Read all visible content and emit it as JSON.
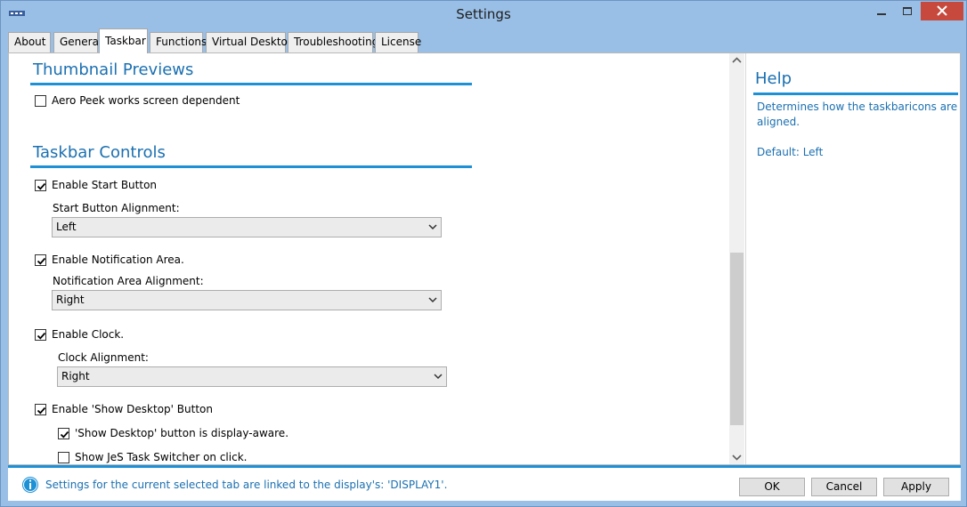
{
  "window": {
    "title": "Settings"
  },
  "tabs": [
    {
      "label": "About"
    },
    {
      "label": "General"
    },
    {
      "label": "Taskbar",
      "active": true
    },
    {
      "label": "Functions"
    },
    {
      "label": "Virtual Desktop"
    },
    {
      "label": "Troubleshooting"
    },
    {
      "label": "License"
    }
  ],
  "thumbnail": {
    "title": "Thumbnail Previews",
    "aero_peek": {
      "label": "Aero Peek works screen dependent",
      "checked": false
    }
  },
  "controls": {
    "title": "Taskbar Controls",
    "start_button": {
      "label": "Enable Start Button",
      "checked": true
    },
    "start_alignment": {
      "label": "Start Button Alignment:",
      "value": "Left"
    },
    "notification": {
      "label": "Enable Notification Area.",
      "checked": true
    },
    "notification_alignment": {
      "label": "Notification Area Alignment:",
      "value": "Right"
    },
    "clock": {
      "label": "Enable Clock.",
      "checked": true
    },
    "clock_alignment": {
      "label": "Clock Alignment:",
      "value": "Right"
    },
    "show_desktop": {
      "label": "Enable 'Show Desktop' Button",
      "checked": true
    },
    "display_aware": {
      "label": "'Show Desktop' button is display-aware.",
      "checked": true
    },
    "task_switcher": {
      "label": "Show JeS Task Switcher on click.",
      "checked": false
    }
  },
  "help": {
    "title": "Help",
    "text": "Determines how the taskbaricons are aligned.",
    "default": "Default: Left"
  },
  "footer": {
    "info": "Settings for the current selected  tab are linked to the display's: 'DISPLAY1'.",
    "ok": "OK",
    "cancel": "Cancel",
    "apply": "Apply"
  },
  "colors": {
    "accent": "#1e91d6",
    "heading": "#1b70b1",
    "frame": "#99bfe6"
  }
}
